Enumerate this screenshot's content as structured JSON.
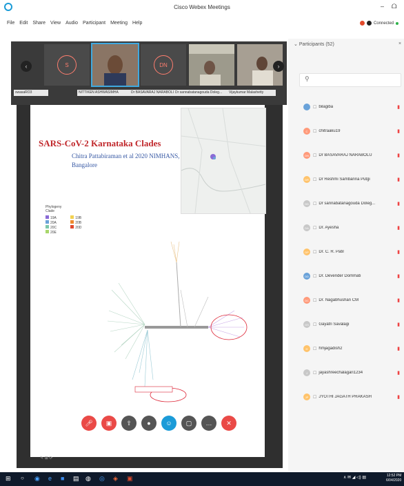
{
  "window": {
    "title": "Cisco Webex Meetings",
    "min": "–",
    "restore": "ᗝ"
  },
  "menu": [
    "File",
    "Edit",
    "Share",
    "View",
    "Audio",
    "Participant",
    "Meeting",
    "Help"
  ],
  "status": {
    "connected": "Connected"
  },
  "video_strip": {
    "tiles": [
      {
        "initial": "S",
        "label": "swasaRO3"
      },
      {
        "initial": "",
        "label": "NITTIKEN ASHWASIMHA"
      },
      {
        "initial": "DN",
        "label": "Dr BASAVARAJ NARABOLU"
      },
      {
        "initial": "",
        "label": "Dr sannabatanagouda Doleg..."
      },
      {
        "initial": "",
        "label": "Vijaykumar Malashetty"
      }
    ]
  },
  "slide": {
    "title": "SARS-CoV-2 Karnataka Clades",
    "subtitle": "Chitra Pattabiraman et al 2020 NIMHANS, Bangalore",
    "legend": {
      "title": "Phylogeny",
      "subtitle": "Clade",
      "items": [
        {
          "label": "19A",
          "color": "#8a6bd6"
        },
        {
          "label": "19B",
          "color": "#f2d152"
        },
        {
          "label": "20A",
          "color": "#6aa2d9"
        },
        {
          "label": "20B",
          "color": "#ef8a2e"
        },
        {
          "label": "20C",
          "color": "#7cc8a8"
        },
        {
          "label": "20D",
          "color": "#e04a2f"
        },
        {
          "label": "20E",
          "color": "#a8d66b"
        }
      ]
    }
  },
  "controls": [
    {
      "name": "mute-button",
      "icon": "mic",
      "color": "#ea4a47"
    },
    {
      "name": "video-button",
      "icon": "video",
      "color": "#ea4a47"
    },
    {
      "name": "share-button",
      "icon": "share",
      "color": "#555555"
    },
    {
      "name": "record-button",
      "icon": "record",
      "color": "#555555"
    },
    {
      "name": "participants-button",
      "icon": "person",
      "color": "#1b9bd8"
    },
    {
      "name": "chat-button",
      "icon": "chat",
      "color": "#555555"
    },
    {
      "name": "more-button",
      "icon": "more",
      "color": "#555555"
    },
    {
      "name": "leave-button",
      "icon": "close",
      "color": "#ea4a47"
    }
  ],
  "panel": {
    "title": "Participants (52)",
    "search_placeholder": "",
    "participants": [
      {
        "initials": "",
        "name": "bilagiba",
        "color": "#6aa2d9"
      },
      {
        "initials": "C",
        "name": "chitraaku19",
        "color": "#ff9a7a"
      },
      {
        "initials": "DN",
        "name": "Dr BASAVARAJ NARABOLU",
        "color": "#ff9a7a"
      },
      {
        "initials": "DR",
        "name": "Dr Reshmi Sambanna Putgi",
        "color": "#ffc36b"
      },
      {
        "initials": "DD",
        "name": "Dr sannabatanagouda Doleg...",
        "color": "#c8c8c8"
      },
      {
        "initials": "DA",
        "name": "Dr. Ayesha",
        "color": "#c8c8c8"
      },
      {
        "initials": "DP",
        "name": "Dr. C. R. Patil",
        "color": "#ffc36b"
      },
      {
        "initials": "DD",
        "name": "Dr. Devender Dommati",
        "color": "#6aa2d9"
      },
      {
        "initials": "DC",
        "name": "Dr. Nagabhushan CM",
        "color": "#ff9a7a"
      },
      {
        "initials": "GS",
        "name": "Gayatri Savalagi",
        "color": "#c8c8c8"
      },
      {
        "initials": "H",
        "name": "hmjagadish2",
        "color": "#ffc36b"
      },
      {
        "initials": "J",
        "name": "jayashreechalagari1234",
        "color": "#c8c8c8"
      },
      {
        "initials": "JP",
        "name": "JYOTHI JAGATH PRAKASH",
        "color": "#ffc36b"
      }
    ]
  },
  "taskbar": {
    "time": "12:52 PM",
    "date": "6/04/2020"
  }
}
